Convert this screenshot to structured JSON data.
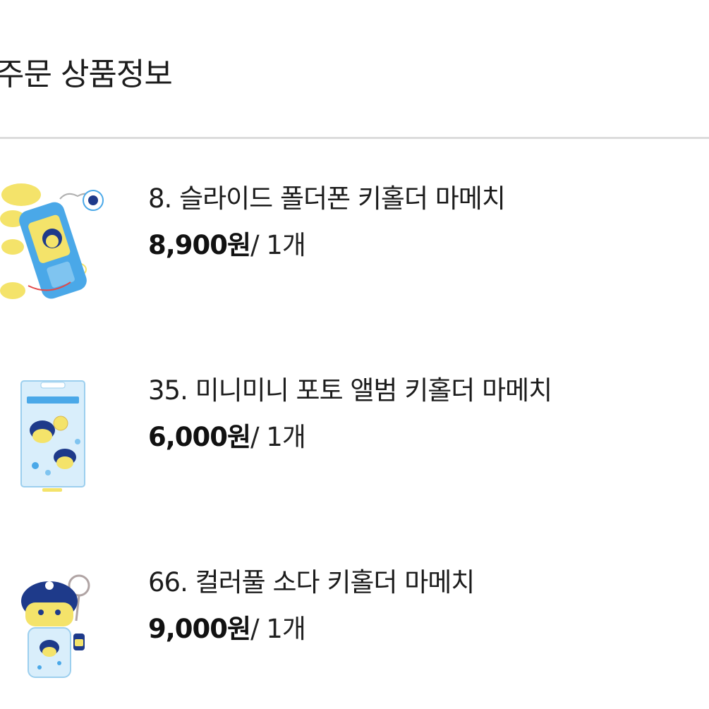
{
  "section": {
    "title": "주문 상품정보"
  },
  "items": [
    {
      "name": "8. 슬라이드 폴더폰 키홀더 마메치",
      "price": "8,900원",
      "quantity": "/ 1개",
      "thumbnail_icon": "slide-folder-phone-keyholder-icon"
    },
    {
      "name": "35. 미니미니 포토 앨범 키홀더 마메치",
      "price": "6,000원",
      "quantity": "/ 1개",
      "thumbnail_icon": "mini-photo-album-keyholder-icon"
    },
    {
      "name": "66. 컬러풀 소다 키홀더 마메치",
      "price": "9,000원",
      "quantity": "/ 1개",
      "thumbnail_icon": "colorful-soda-keyholder-icon"
    }
  ],
  "colors": {
    "divider": "#dcdcdc",
    "text": "#1c1c1c",
    "accent_blue": "#4aa8e8",
    "character_navy": "#1e3a8a",
    "character_yellow": "#f4e36a"
  }
}
